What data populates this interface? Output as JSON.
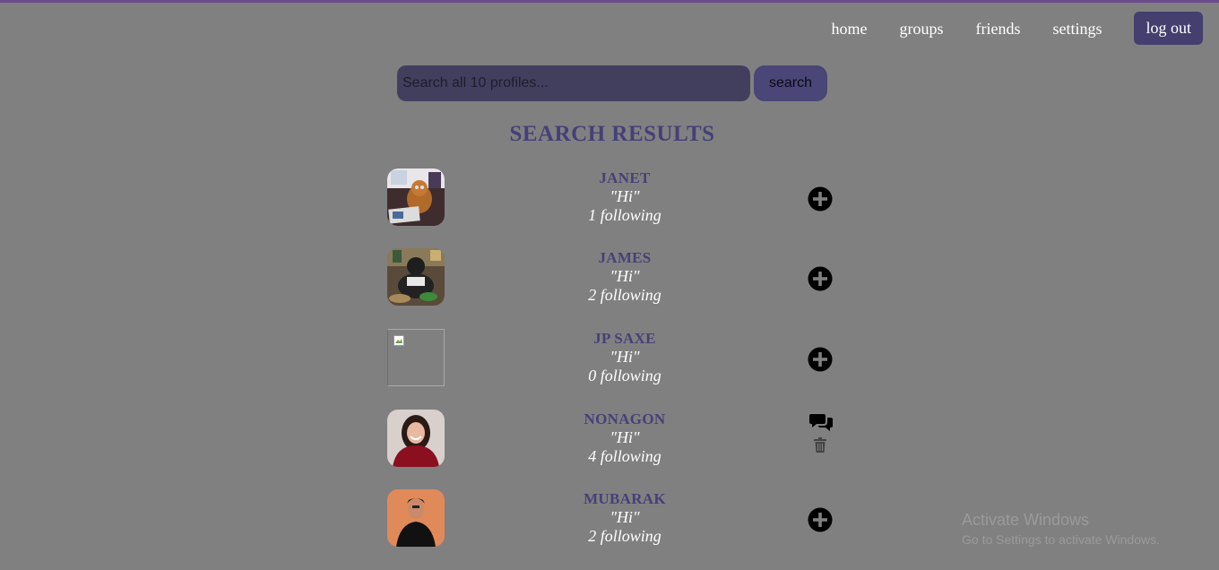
{
  "nav": {
    "items": [
      {
        "label": "home"
      },
      {
        "label": "groups"
      },
      {
        "label": "friends"
      },
      {
        "label": "settings"
      }
    ],
    "logout_label": "log out"
  },
  "search": {
    "placeholder": "Search all 10 profiles...",
    "value": "",
    "button_label": "search"
  },
  "results": {
    "title": "SEARCH RESULTS",
    "items": [
      {
        "name": "JANET",
        "quote": "\"Hi\"",
        "following": "1 following",
        "action": "add-icon",
        "avatar": "photo-dog"
      },
      {
        "name": "JAMES",
        "quote": "\"Hi\"",
        "following": "2 following",
        "action": "add-icon",
        "avatar": "photo-chef"
      },
      {
        "name": "JP SAXE",
        "quote": "\"Hi\"",
        "following": "0 following",
        "action": "add-icon",
        "avatar": "broken-image-icon"
      },
      {
        "name": "NONAGON",
        "quote": "\"Hi\"",
        "following": "4 following",
        "action": "chat-icon,trash-icon",
        "avatar": "photo-woman-red"
      },
      {
        "name": "MUBARAK",
        "quote": "\"Hi\"",
        "following": "2 following",
        "action": "add-icon",
        "avatar": "photo-man-orange"
      }
    ]
  },
  "watermark": {
    "line1": "Activate Windows",
    "line2": "Go to Settings to activate Windows."
  },
  "colors": {
    "background": "#808080",
    "accent": "#454079",
    "button": "#443f6e"
  }
}
